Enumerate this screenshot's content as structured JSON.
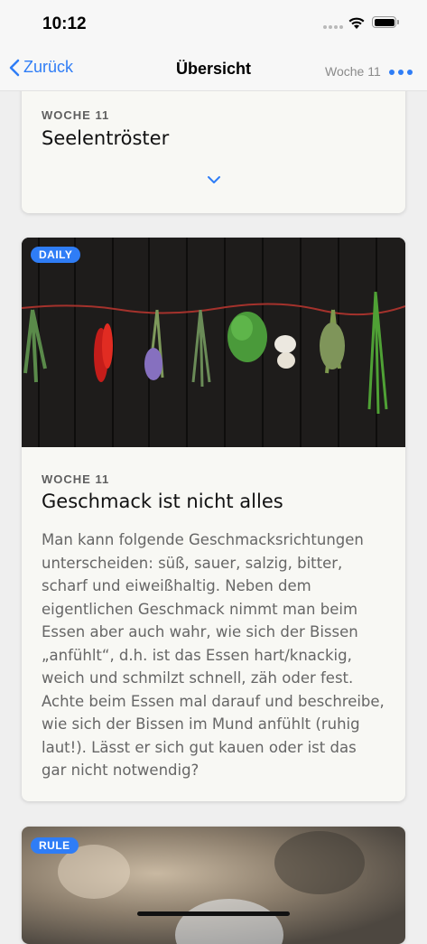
{
  "status_bar": {
    "time": "10:12"
  },
  "nav": {
    "back_label": "Zurück",
    "title": "Übersicht",
    "week_label": "Woche 11"
  },
  "cards": [
    {
      "week": "WOCHE 11",
      "title": "Seelentröster"
    },
    {
      "badge": "DAILY",
      "week": "WOCHE 11",
      "title": "Geschmack ist nicht alles",
      "text": "Man kann folgende Geschmacksrichtungen unterscheiden: süß, sauer, salzig, bitter, scharf und eiweißhaltig. Neben dem eigentlichen Geschmack nimmt man beim Essen aber auch wahr, wie sich der Bissen „anfühlt“, d.h. ist das Essen hart/knackig, weich und schmilzt schnell, zäh oder fest. Achte beim Essen mal darauf und beschreibe, wie sich der Bissen im Mund anfühlt (ruhig laut!). Lässt er sich gut kauen oder ist das gar nicht notwendig?"
    },
    {
      "badge": "RULE"
    }
  ],
  "colors": {
    "accent": "#2f7df6",
    "card_bg": "#f8f8f4"
  }
}
